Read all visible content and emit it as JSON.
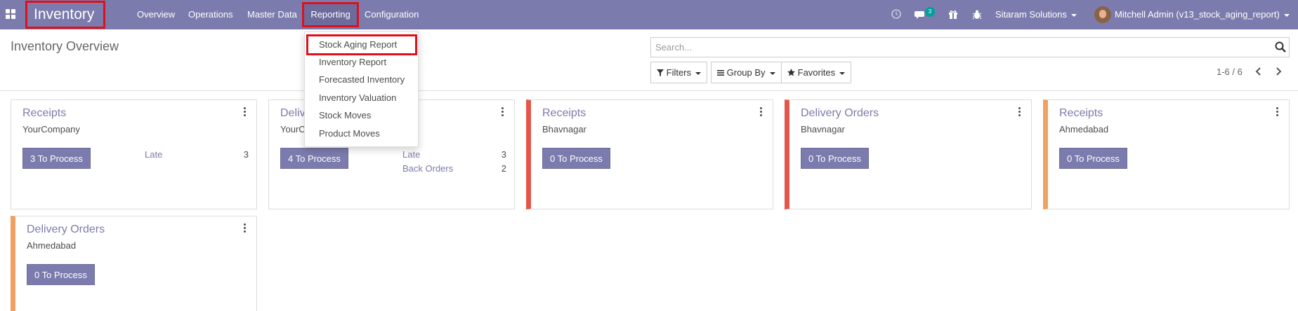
{
  "navbar": {
    "apps_icon": "apps-grid-icon",
    "brand": "Inventory",
    "menu": [
      "Overview",
      "Operations",
      "Master Data",
      "Reporting",
      "Configuration"
    ],
    "icons": [
      "clock-icon",
      "chat-icon",
      "gift-icon",
      "bug-icon"
    ],
    "chat_badge": "3",
    "company": "Sitaram Solutions",
    "user": "Mitchell Admin (v13_stock_aging_report)"
  },
  "control_panel": {
    "title": "Inventory Overview",
    "search_placeholder": "Search...",
    "filters": "Filters",
    "group_by": "Group By",
    "favorites": "Favorites",
    "pager": "1-6 / 6"
  },
  "reporting_menu": {
    "items": [
      "Stock Aging Report",
      "Inventory Report",
      "Forecasted Inventory",
      "Inventory Valuation",
      "Stock Moves",
      "Product Moves"
    ]
  },
  "cards": [
    {
      "title": "Receipts",
      "warehouse": "YourCompany",
      "button": "3 To Process",
      "stats": [
        {
          "label": "Late",
          "value": "3"
        }
      ]
    },
    {
      "title": "Delivery Orders",
      "title_visible": "Delive",
      "warehouse": "YourCompany",
      "warehouse_visible": "YourC",
      "button": "4 To Process",
      "stats": [
        {
          "label": "Late",
          "value": "3"
        },
        {
          "label": "Back Orders",
          "value": "2"
        }
      ]
    },
    {
      "title": "Receipts",
      "warehouse": "Bhavnagar",
      "button": "0 To Process",
      "stats": []
    },
    {
      "title": "Delivery Orders",
      "warehouse": "Bhavnagar",
      "button": "0 To Process",
      "stats": []
    },
    {
      "title": "Receipts",
      "warehouse": "Ahmedabad",
      "button": "0 To Process",
      "stats": []
    },
    {
      "title": "Delivery Orders",
      "warehouse": "Ahmedabad",
      "button": "0 To Process",
      "stats": []
    }
  ],
  "colors": {
    "brand": "#7c7bad",
    "highlight_border": "#e0101a",
    "late_stripe": "#e4564b",
    "warn_stripe": "#f0a060",
    "badge": "#00a09d"
  }
}
